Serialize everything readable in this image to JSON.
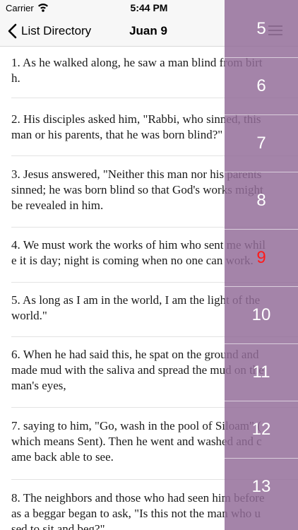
{
  "status_bar": {
    "carrier": "Carrier",
    "time": "5:44 PM"
  },
  "nav": {
    "back_label": "List Directory",
    "title": "Juan 9"
  },
  "verses": [
    {
      "line1": "1. As he walked along, he saw a man blind from birt",
      "line2": "h."
    },
    {
      "line1": "2. His disciples asked him, \"Rabbi, who sinned, this",
      "line2": "man or his parents, that he was born blind?\""
    },
    {
      "line1": "3. Jesus answered, \"Neither this man nor his parents",
      "line2": "sinned; he was born blind so that God's works might",
      "line3": "be revealed in him."
    },
    {
      "line1": "4. We must work the works of him who sent me whil",
      "line2": "e it is day; night is coming when no one can work."
    },
    {
      "line1": "5. As long as I am in the world, I am the light of the",
      "line2": "world.\""
    },
    {
      "line1": "6. When he had said this, he spat on the ground and",
      "line2": "made mud with the saliva and spread the mud on the",
      "line3": " man's eyes,"
    },
    {
      "line1": "7. saying to him, \"Go, wash in the pool of Siloam\" (",
      "line2": "which means Sent). Then he went and washed and c",
      "line3": "ame back able to see."
    },
    {
      "line1": "8. The neighbors and those who had seen him before",
      "line2": " as a beggar began to ask, \"Is this not the man who u",
      "line3": "sed to sit and beg?\""
    }
  ],
  "chapters": [
    "5",
    "6",
    "7",
    "8",
    "9",
    "10",
    "11",
    "12",
    "13"
  ],
  "selected_chapter": "9",
  "colors": {
    "index_bg": "#936c98",
    "selected": "#ff1a1a"
  }
}
